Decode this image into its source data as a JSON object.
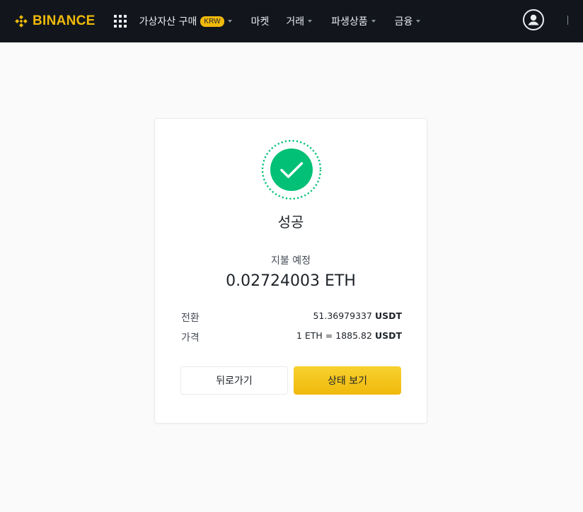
{
  "brand": {
    "name": "BINANCE",
    "color": "#f0b90b"
  },
  "nav": {
    "items": [
      {
        "label": "가상자산 구매",
        "badge": "KRW",
        "has_caret": true
      },
      {
        "label": "마켓",
        "has_caret": false
      },
      {
        "label": "거래",
        "has_caret": true
      },
      {
        "label": "파생상품",
        "has_caret": true
      },
      {
        "label": "금융",
        "has_caret": true
      }
    ]
  },
  "icons": {
    "apps": "grid-icon",
    "user": "user-circle-icon",
    "success": "check-circle-icon"
  },
  "result": {
    "status": "성공",
    "amount_label": "지불 예정",
    "amount_value": "0.02724003 ETH",
    "details": [
      {
        "key": "전환",
        "value": "51.36979337",
        "unit": "USDT"
      },
      {
        "key": "가격",
        "value": "1 ETH = 1885.82",
        "unit": "USDT"
      }
    ],
    "back_label": "뒤로가기",
    "status_label": "상태 보기"
  },
  "colors": {
    "success": "#02c076",
    "topbar": "#12161c",
    "accent": "#f0b90b"
  }
}
